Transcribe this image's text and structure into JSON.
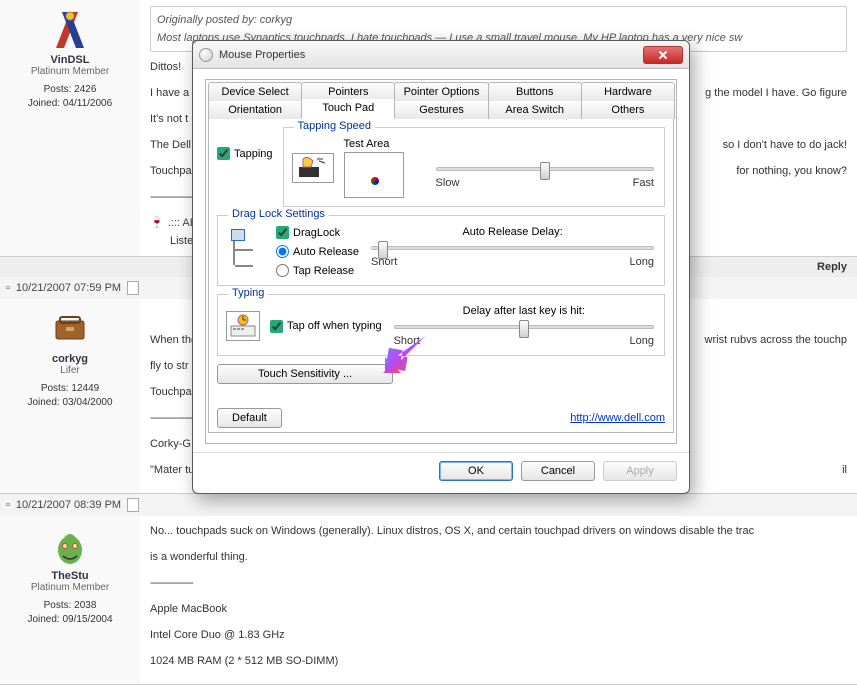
{
  "posts": [
    {
      "name": "VinDSL",
      "title": "Platinum Member",
      "posts": "Posts: 2426",
      "joined": "Joined: 04/11/2006",
      "quote_label": "Originally posted by: corkyg",
      "quote_text": "Most laptops use Synaptics touchpads. I hate touchpads — I use a small travel mouse.    My HP laptop has a very nice sw",
      "lines": {
        "l1": "Dittos!",
        "l2": "I have a",
        "l2b": "g the model I have. Go figure",
        "l3": "It's not t",
        "l4": "The Dell",
        "l4b": "so I don't have to do jack!",
        "l5": "Touchpa",
        "l5b": "for nothing, you know?",
        "sig1": ".::: ABL²",
        "sig2": "Listen"
      }
    },
    {
      "datebar": "10/21/2007 07:59 PM",
      "name": "corkyg",
      "title": "Lifer",
      "posts": "Posts: 12449",
      "joined": "Joined: 03/04/2000",
      "lines": {
        "l1a": "When the",
        "l1b": "wrist rubvs across the touchp",
        "l2": "fly to str",
        "l3": "Touchpa",
        "l4": "Corky-G",
        "l5a": "\"Mater tu",
        "l5b": "il"
      }
    },
    {
      "datebar": "10/21/2007 08:39 PM",
      "name": "TheStu",
      "title": "Platinum Member",
      "posts": "Posts: 2038",
      "joined": "Joined: 09/15/2004",
      "lines": {
        "l1": "No... touchpads suck on Windows (generally). Linux distros, OS X, and certain touchpad drivers on windows disable the trac",
        "l2": "is a wonderful thing.",
        "s1": "Apple MacBook",
        "s2": "Intel Core Duo @ 1.83 GHz",
        "s3": "1024 MB RAM (2 * 512 MB SO-DIMM)"
      }
    }
  ],
  "reply_label": "Reply",
  "dialog": {
    "title": "Mouse Properties",
    "tabs_row1": [
      "Device Select",
      "Pointers",
      "Pointer Options",
      "Buttons",
      "Hardware"
    ],
    "tabs_row2": [
      "Orientation",
      "Touch Pad",
      "Gestures",
      "Area Switch",
      "Others"
    ],
    "active_tab": "Touch Pad",
    "tapping": {
      "group": "Tapping Speed",
      "checkbox": "Tapping",
      "test_area": "Test Area",
      "slow": "Slow",
      "fast": "Fast"
    },
    "draglock": {
      "group": "Drag Lock Settings",
      "checkbox": "DragLock",
      "radio1": "Auto Release",
      "radio2": "Tap Release",
      "delay_title": "Auto Release Delay:",
      "short": "Short",
      "long": "Long"
    },
    "typing": {
      "group": "Typing",
      "checkbox": "Tap off when typing",
      "delay_title": "Delay after last key is hit:",
      "short": "Short",
      "long": "Long"
    },
    "touch_sensitivity": "Touch Sensitivity ...",
    "default_btn": "Default",
    "link": "http://www.dell.com",
    "ok": "OK",
    "cancel": "Cancel",
    "apply": "Apply"
  }
}
